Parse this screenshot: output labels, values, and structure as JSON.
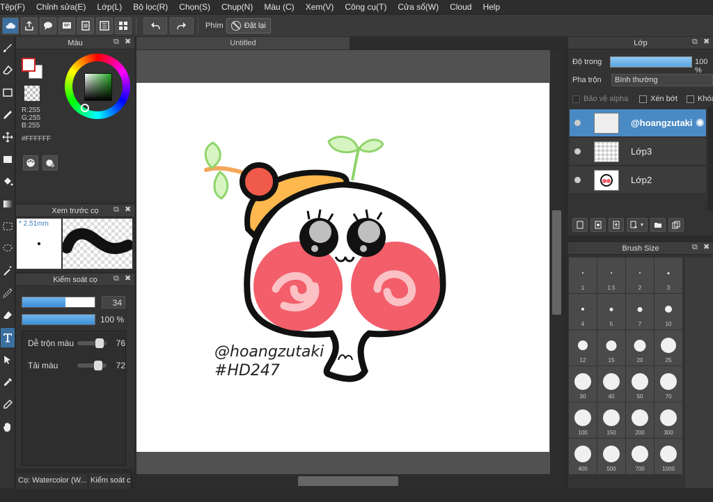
{
  "menu": [
    "Tệp(F)",
    "Chỉnh sửa(E)",
    "Lớp(L)",
    "Bộ lọc(R)",
    "Chọn(S)",
    "Chụp(N)",
    "Màu (C)",
    "Xem(V)",
    "Công cụ(T)",
    "Cửa sổ(W)",
    "Cloud",
    "Help"
  ],
  "toolbar": {
    "key_label": "Phím",
    "reset_label": "Đặt lại"
  },
  "color_panel": {
    "title": "Màu",
    "r": "R:255",
    "g": "G:255",
    "b": "B:255",
    "hex": "#FFFFFF",
    "fg_color": "#FFFFFF",
    "accent": "#D32020"
  },
  "preview_panel": {
    "title": "Xem trước cọ",
    "size": "* 2.51mm"
  },
  "brush_control": {
    "title": "Kiểm soát cọ",
    "size_value": "34",
    "size_fraction": 0.6,
    "opacity_value": "100 %",
    "opacity_fraction": 1.0,
    "blend_label": "Dễ trộn màu",
    "blend_value": "76",
    "blend_fraction": 0.76,
    "paint_label": "Tải màu",
    "paint_value": "72",
    "paint_fraction": 0.72
  },
  "bottom_tabs": [
    "Cọ: Watercolor (W...",
    "Kiểm soát c"
  ],
  "document": {
    "tab_title": "Untitled"
  },
  "artwork": {
    "line1": "@hoangzutaki",
    "line2": "#HD247"
  },
  "layers_panel": {
    "title": "Lớp",
    "opacity_label": "Độ trong",
    "opacity_value": "100 %",
    "blend_label": "Pha trộn",
    "blend_value": "Bình thường",
    "protect_alpha": "Bảo vệ alpha",
    "clipping": "Xén bớt",
    "lock": "Khóa",
    "layers": [
      {
        "name": "@hoangzutaki",
        "selected": true
      },
      {
        "name": "Lớp3",
        "selected": false
      },
      {
        "name": "Lớp2",
        "selected": false
      }
    ]
  },
  "brush_size_panel": {
    "title": "Brush Size",
    "sizes": [
      "1",
      "1.5",
      "2",
      "3",
      "4",
      "5",
      "7",
      "10",
      "12",
      "15",
      "20",
      "25",
      "30",
      "40",
      "50",
      "70",
      "100",
      "150",
      "200",
      "300",
      "400",
      "500",
      "700",
      "1000"
    ]
  }
}
